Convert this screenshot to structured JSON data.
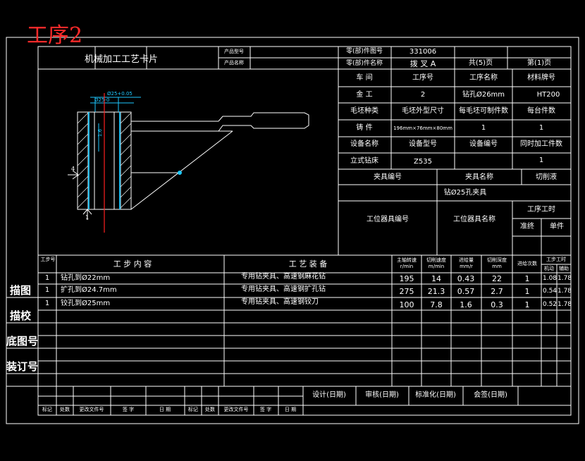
{
  "heading": "工序2",
  "card_title": "机械加工工艺卡片",
  "header": {
    "product_model_label": "产品型号",
    "product_name_label": "产品名称",
    "part_drawing_label": "零(部)件图号",
    "part_drawing_value": "331006",
    "part_name_label": "零(部)件名称",
    "part_name_value": "拨 叉 A",
    "total_pages": "共(5)页",
    "page_no": "第(1)页"
  },
  "info": {
    "r1": [
      "车 间",
      "工序号",
      "工序名称",
      "材料牌号"
    ],
    "r2": [
      "金 工",
      "2",
      "钻孔Ø26mm",
      "HT200"
    ],
    "r3": [
      "毛坯种类",
      "毛坯外型尺寸",
      "每毛坯可制件数",
      "每台件数"
    ],
    "r4": [
      "铸 件",
      "196mm×76mm×80mm",
      "1",
      "1"
    ],
    "r5": [
      "设备名称",
      "设备型号",
      "设备编号",
      "同时加工件数"
    ],
    "r6": [
      "立式钻床",
      "Z535",
      "",
      "1"
    ],
    "fixture_no": "夹具编号",
    "fixture_name": "夹具名称",
    "coolant": "切削液",
    "fixture_value": "钻Ø25孔夹具",
    "station_no": "工位器具编号",
    "station_name": "工位器具名称",
    "time_label": "工序工时",
    "prep_label": "准终",
    "unit_label": "单件"
  },
  "steps_header": {
    "no": "工步号",
    "content": "工 步 内 容",
    "equipment": "工 艺 装 备",
    "spindle": "主轴转速 r/min",
    "speed": "切削速度 m/min",
    "feed": "进给量 mm/r",
    "depth": "切削深度 mm",
    "passes": "进给次数",
    "step_time": "工步工时",
    "machine": "机动",
    "aux": "辅助"
  },
  "steps": [
    {
      "no": "1",
      "content": "钻孔到Ø22mm",
      "equip": "专用钻夹具、高速钢麻花钻",
      "spindle": "195",
      "speed": "14",
      "feed": "0.43",
      "depth": "22",
      "passes": "1",
      "machine": "1.08",
      "aux": "1.78"
    },
    {
      "no": "1",
      "content": "扩孔到Ø24.7mm",
      "equip": "专用钻夹具、高速钢扩孔钻",
      "spindle": "275",
      "speed": "21.3",
      "feed": "0.57",
      "depth": "2.7",
      "passes": "1",
      "machine": "0.54",
      "aux": "1.78"
    },
    {
      "no": "1",
      "content": "铰孔到Ø25mm",
      "equip": "专用钻夹具、高速钢铰刀",
      "spindle": "100",
      "speed": "7.8",
      "feed": "1.6",
      "depth": "0.3",
      "passes": "1",
      "machine": "0.52",
      "aux": "1.78"
    }
  ],
  "side_labels": [
    "描图",
    "描校",
    "底图号",
    "装订号"
  ],
  "signoff": [
    "设计(日期)",
    "审核(日期)",
    "标准化(日期)",
    "会签(日期)"
  ],
  "bottom": [
    "标记",
    "处数",
    "更改文件号",
    "签 字",
    "日 期",
    "标记",
    "处数",
    "更改文件号",
    "签 字",
    "日 期"
  ],
  "drawing": {
    "dim_top": "Ø25+0.05",
    "dim_sub": "Ø25-0",
    "dim_ra": "1.6",
    "mark_a": "4",
    "mark_b": "1"
  }
}
